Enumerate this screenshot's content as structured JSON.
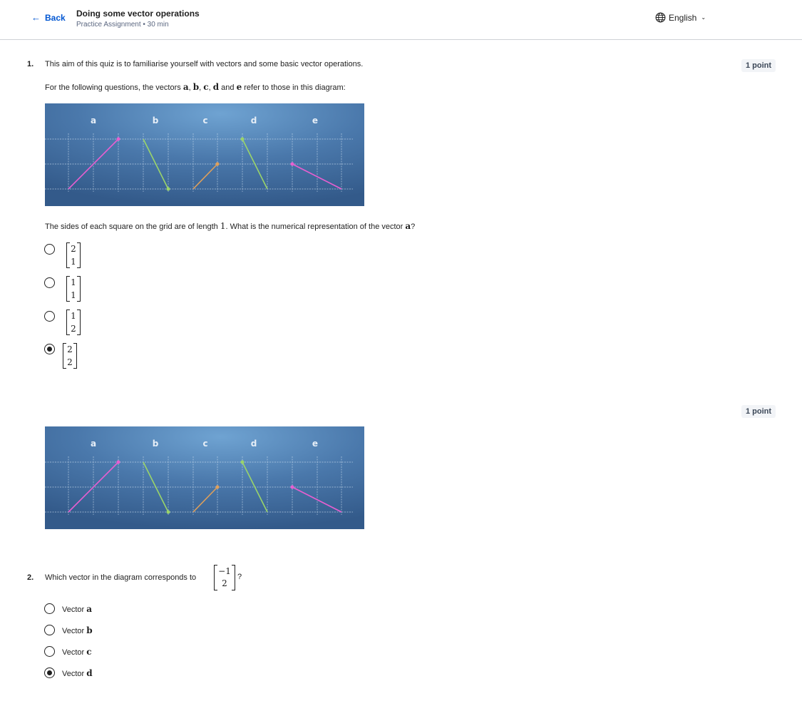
{
  "header": {
    "back_label": "Back",
    "title": "Doing some vector operations",
    "subtitle": "Practice Assignment • 30 min",
    "language": "English"
  },
  "q1": {
    "number": "1.",
    "points": "1 point",
    "intro": "This aim of this quiz is to familiarise yourself with vectors and some basic vector operations.",
    "diagram_pre": "For the following questions, the vectors",
    "diagram_post": "refer to those in this diagram:",
    "grid_pre": "The sides of each square on the grid are of length",
    "grid_len": "1",
    "grid_post": ". What is the numerical representation of the vector",
    "vector": "a",
    "qmark": "?",
    "options": [
      {
        "top": "2",
        "bottom": "1",
        "selected": false
      },
      {
        "top": "1",
        "bottom": "1",
        "selected": false
      },
      {
        "top": "1",
        "bottom": "2",
        "selected": false
      },
      {
        "top": "2",
        "bottom": "2",
        "selected": true
      }
    ]
  },
  "vector_names": [
    "a",
    "b",
    "c",
    "d",
    "e"
  ],
  "conj_and": "and",
  "comma": ",",
  "q2": {
    "number": "2.",
    "points": "1 point",
    "question": "Which vector in the diagram corresponds to",
    "matrix_top": "−1",
    "matrix_bottom": "2",
    "qmark": "?",
    "option_prefix": "Vector",
    "options": [
      {
        "vec": "a",
        "selected": false
      },
      {
        "vec": "b",
        "selected": false
      },
      {
        "vec": "c",
        "selected": false
      },
      {
        "vec": "d",
        "selected": true
      }
    ]
  },
  "colors": {
    "link": "#0056d2",
    "diagram_bg": "#3f6a9a",
    "vec_a": "#e85fd0",
    "vec_b": "#9ad46a",
    "vec_c": "#e0a05a",
    "vec_d": "#9ad46a",
    "vec_e": "#e85fd0"
  }
}
